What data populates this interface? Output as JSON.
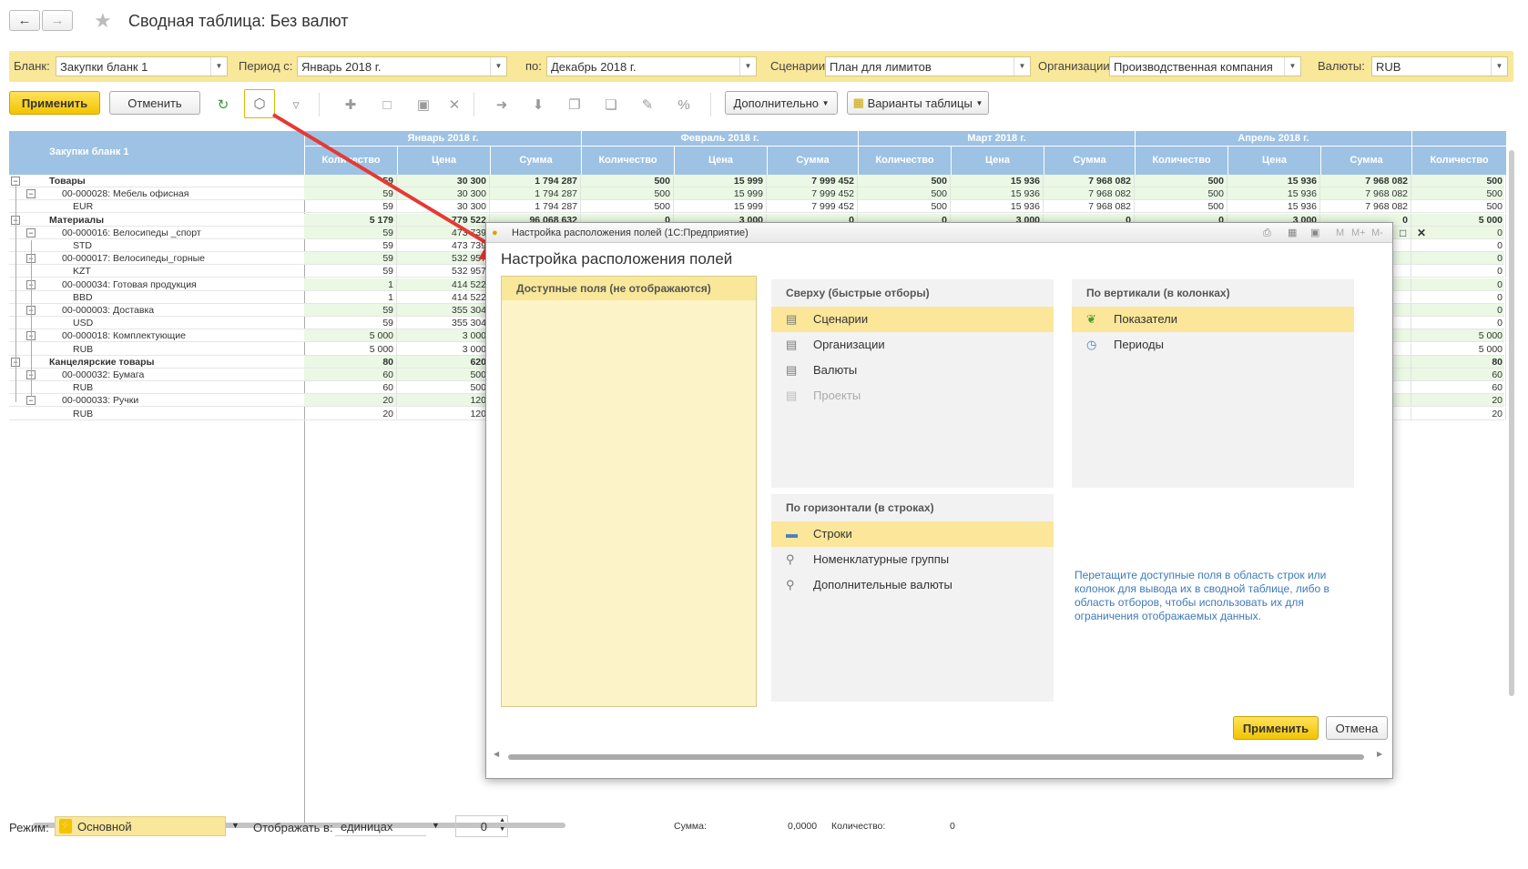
{
  "window": {
    "title": "Сводная таблица: Без валют"
  },
  "filters": {
    "blank_label": "Бланк:",
    "blank_value": "Закупки бланк 1",
    "period_from_label": "Период с:",
    "period_from_value": "Январь 2018 г.",
    "period_to_label": "по:",
    "period_to_value": "Декабрь 2018 г.",
    "scenario_label": "Сценарии:",
    "scenario_value": "План для лимитов",
    "org_label": "Организации:",
    "org_value": "Производственная компания",
    "currency_label": "Валюты:",
    "currency_value": "RUB"
  },
  "toolbar": {
    "apply": "Применить",
    "cancel": "Отменить",
    "more": "Дополнительно",
    "variants": "Варианты таблицы"
  },
  "grid": {
    "corner": "Закупки бланк 1",
    "periods": [
      "Январь 2018 г.",
      "Февраль 2018 г.",
      "Март 2018 г.",
      "Апрель 2018 г."
    ],
    "columns": [
      "Количество",
      "Цена",
      "Сумма"
    ],
    "rows": [
      {
        "label": "Товары",
        "level": 0,
        "bold": true,
        "v": [
          "59",
          "30 300",
          "1 794 287",
          "500",
          "15 999",
          "7 999 452",
          "500",
          "15 936",
          "7 968 082",
          "500",
          "15 936",
          "7 968 082",
          "500"
        ]
      },
      {
        "label": "00-000028: Мебель офисная",
        "level": 1,
        "bold": false,
        "v": [
          "59",
          "30 300",
          "1 794 287",
          "500",
          "15 999",
          "7 999 452",
          "500",
          "15 936",
          "7 968 082",
          "500",
          "15 936",
          "7 968 082",
          "500"
        ]
      },
      {
        "label": "EUR",
        "level": 2,
        "bold": false,
        "v": [
          "59",
          "30 300",
          "1 794 287",
          "500",
          "15 999",
          "7 999 452",
          "500",
          "15 936",
          "7 968 082",
          "500",
          "15 936",
          "7 968 082",
          "500"
        ]
      },
      {
        "label": "Материалы",
        "level": 0,
        "bold": true,
        "v": [
          "5 179",
          "779 522",
          "96 068 632",
          "0",
          "3 000",
          "0",
          "0",
          "3 000",
          "0",
          "0",
          "3 000",
          "0",
          "5 000"
        ]
      },
      {
        "label": "00-000016: Велосипеды _спорт",
        "level": 1,
        "bold": false,
        "v": [
          "59",
          "473 739",
          "",
          "",
          "",
          "",
          "",
          "",
          "",
          "",
          "",
          "",
          "0"
        ]
      },
      {
        "label": "STD",
        "level": 2,
        "bold": false,
        "v": [
          "59",
          "473 739",
          "",
          "",
          "",
          "",
          "",
          "",
          "",
          "",
          "",
          "",
          "0"
        ]
      },
      {
        "label": "00-000017: Велосипеды_горные",
        "level": 1,
        "bold": false,
        "v": [
          "59",
          "532 957",
          "",
          "",
          "",
          "",
          "",
          "",
          "",
          "",
          "",
          "",
          "0"
        ]
      },
      {
        "label": "KZT",
        "level": 2,
        "bold": false,
        "v": [
          "59",
          "532 957",
          "",
          "",
          "",
          "",
          "",
          "",
          "",
          "",
          "",
          "",
          "0"
        ]
      },
      {
        "label": "00-000034: Готовая продукция",
        "level": 1,
        "bold": false,
        "v": [
          "1",
          "414 522",
          "",
          "",
          "",
          "",
          "",
          "",
          "",
          "",
          "",
          "",
          "0"
        ]
      },
      {
        "label": "BBD",
        "level": 2,
        "bold": false,
        "v": [
          "1",
          "414 522",
          "",
          "",
          "",
          "",
          "",
          "",
          "",
          "",
          "",
          "",
          "0"
        ]
      },
      {
        "label": "00-000003: Доставка",
        "level": 1,
        "bold": false,
        "v": [
          "59",
          "355 304",
          "",
          "",
          "",
          "",
          "",
          "",
          "",
          "",
          "",
          "",
          "0"
        ]
      },
      {
        "label": "USD",
        "level": 2,
        "bold": false,
        "v": [
          "59",
          "355 304",
          "",
          "",
          "",
          "",
          "",
          "",
          "",
          "",
          "",
          "",
          "0"
        ]
      },
      {
        "label": "00-000018: Комплектующие",
        "level": 1,
        "bold": false,
        "v": [
          "5 000",
          "3 000",
          "",
          "",
          "",
          "",
          "",
          "",
          "",
          "",
          "",
          "",
          "5 000"
        ]
      },
      {
        "label": "RUB",
        "level": 2,
        "bold": false,
        "v": [
          "5 000",
          "3 000",
          "",
          "",
          "",
          "",
          "",
          "",
          "",
          "",
          "",
          "",
          "5 000"
        ]
      },
      {
        "label": "Канцелярские товары",
        "level": 0,
        "bold": true,
        "v": [
          "80",
          "620",
          "",
          "",
          "",
          "",
          "",
          "",
          "",
          "",
          "",
          "",
          "80"
        ]
      },
      {
        "label": "00-000032: Бумага",
        "level": 1,
        "bold": false,
        "v": [
          "60",
          "500",
          "",
          "",
          "",
          "",
          "",
          "",
          "",
          "",
          "",
          "",
          "60"
        ]
      },
      {
        "label": "RUB",
        "level": 2,
        "bold": false,
        "v": [
          "60",
          "500",
          "",
          "",
          "",
          "",
          "",
          "",
          "",
          "",
          "",
          "",
          "60"
        ]
      },
      {
        "label": "00-000033: Ручки",
        "level": 1,
        "bold": false,
        "v": [
          "20",
          "120",
          "",
          "",
          "",
          "",
          "",
          "",
          "",
          "",
          "",
          "",
          "20"
        ]
      },
      {
        "label": "RUB",
        "level": 2,
        "bold": false,
        "v": [
          "20",
          "120",
          "",
          "",
          "",
          "",
          "",
          "",
          "",
          "",
          "",
          "",
          "20"
        ]
      }
    ]
  },
  "dialog": {
    "window_title": "Настройка расположения полей (1С:Предприятие)",
    "heading": "Настройка расположения полей",
    "available_header": "Доступные поля (не отображаются)",
    "top_header": "Сверху (быстрые отборы)",
    "top_items": [
      "Сценарии",
      "Организации",
      "Валюты",
      "Проекты"
    ],
    "vertical_header": "По вертикали (в колонках)",
    "vertical_items": [
      "Показатели",
      "Периоды"
    ],
    "horizontal_header": "По горизонтали (в строках)",
    "horizontal_items": [
      "Строки",
      "Номенклатурные группы",
      "Дополнительные валюты"
    ],
    "hint": "Перетащите доступные поля в область строк или колонок для вывода их в сводной таблице, либо в область отборов, чтобы использовать их для ограничения отображаемых данных.",
    "apply": "Применить",
    "cancel": "Отмена",
    "title_buttons": [
      "M",
      "M+",
      "M-"
    ]
  },
  "status": {
    "mode_label": "Режим:",
    "mode_value": "Основной",
    "display_label": "Отображать в:",
    "display_value": "единицах",
    "spin_value": "0",
    "sum_label": "Сумма:",
    "sum_value": "0,0000",
    "qty_label": "Количество:",
    "qty_value": "0"
  },
  "colors": {
    "accent": "#f2c400",
    "filterbar": "#f9e79a",
    "header": "#9dc2e3",
    "row_green": "#e6f7e0",
    "arrow": "#e53935"
  }
}
